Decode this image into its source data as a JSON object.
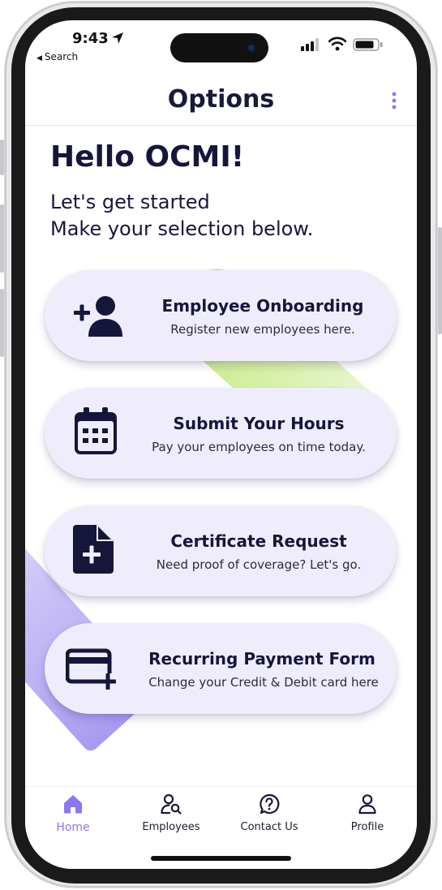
{
  "status_bar": {
    "time": "9:43",
    "back_label": "Search"
  },
  "header": {
    "title": "Options",
    "menu_icon": "more-vertical-icon"
  },
  "greeting": {
    "title": "Hello OCMI!",
    "line1": "Let's get started",
    "line2": "Make your selection below."
  },
  "cards": [
    {
      "title": "Employee Onboarding",
      "description": "Register new employees here.",
      "icon": "add-user-icon"
    },
    {
      "title": "Submit Your Hours",
      "description": "Pay your employees on time today.",
      "icon": "calendar-icon"
    },
    {
      "title": "Certificate Request",
      "description": "Need proof of coverage? Let's go.",
      "icon": "document-add-icon"
    },
    {
      "title": "Recurring Payment Form",
      "description": "Change your Credit & Debit card here",
      "icon": "credit-card-add-icon"
    }
  ],
  "tabs": [
    {
      "label": "Home",
      "icon": "home-icon",
      "active": true
    },
    {
      "label": "Employees",
      "icon": "employees-search-icon",
      "active": false
    },
    {
      "label": "Contact Us",
      "icon": "help-circle-icon",
      "active": false
    },
    {
      "label": "Profile",
      "icon": "profile-icon",
      "active": false
    }
  ],
  "colors": {
    "accent": "#8a78ef",
    "navy": "#16163a",
    "card_bg": "#efedfc",
    "green_blob": "#bfe67a",
    "purple_blob": "#a89bf0"
  }
}
